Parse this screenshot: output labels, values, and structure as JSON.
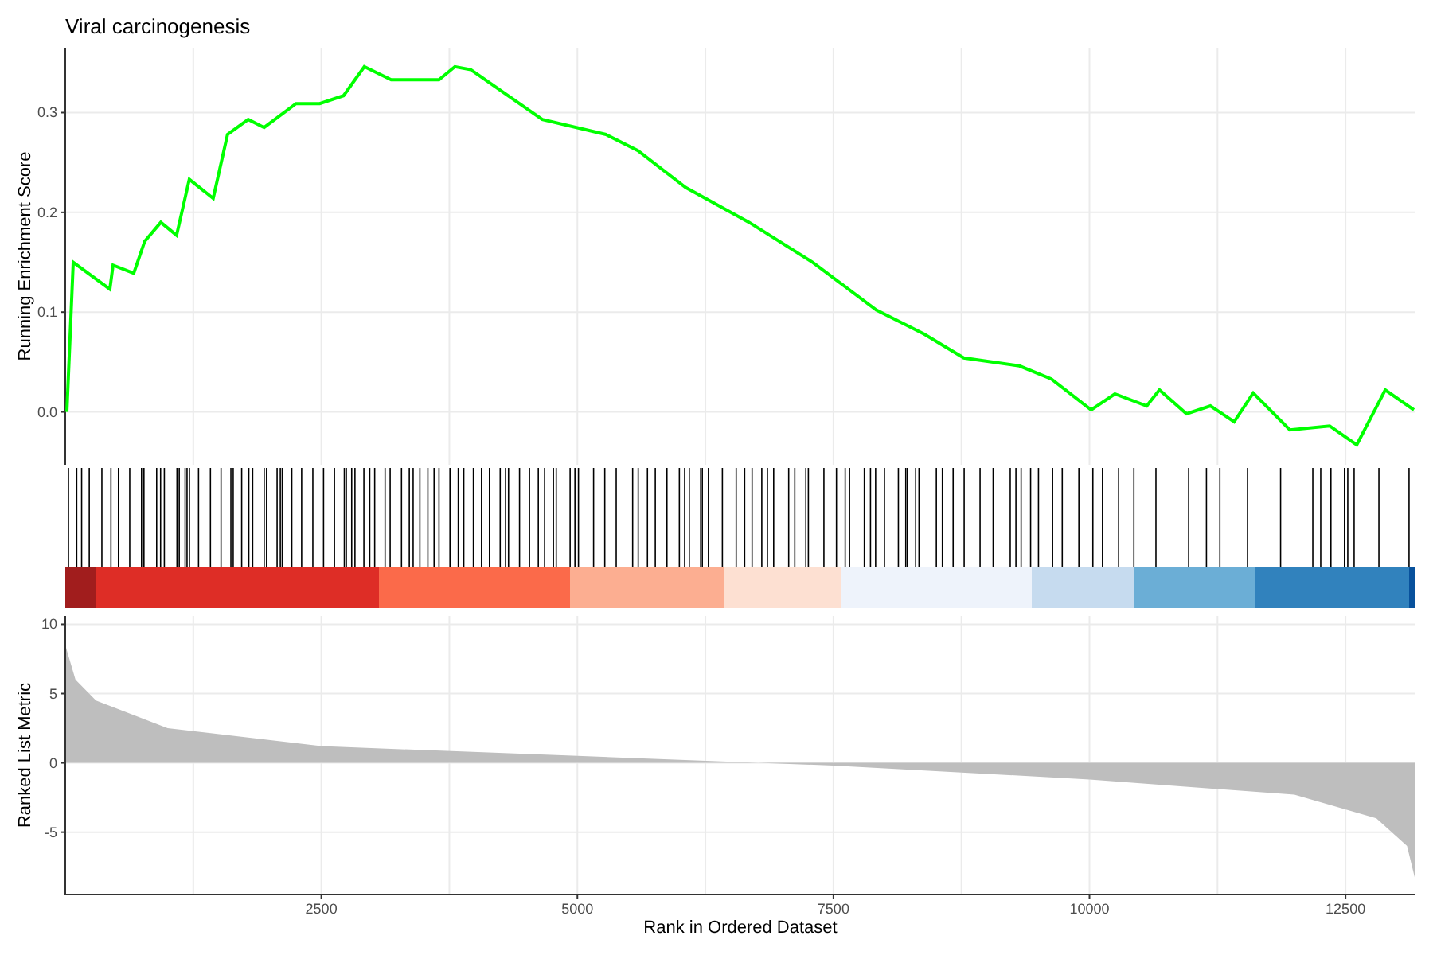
{
  "title": "Viral carcinogenesis",
  "enrichment_panel": {
    "chart_data": {
      "type": "line",
      "ylabel": "Running Enrichment Score",
      "xlim": [
        0,
        13183
      ],
      "ylim": [
        -0.053,
        0.365
      ],
      "grid": true,
      "yticks": [
        {
          "value": 0,
          "label": "0.0"
        },
        {
          "value": 0.1,
          "label": "0.1"
        },
        {
          "value": 0.2,
          "label": "0.2"
        },
        {
          "value": 0.3,
          "label": "0.3"
        }
      ],
      "x": [
        15,
        78,
        435,
        466,
        668,
        776,
        932,
        1087,
        1211,
        1444,
        1584,
        1786,
        1941,
        2252,
        2484,
        2717,
        2919,
        3183,
        3649,
        3804,
        3960,
        4658,
        5280,
        5590,
        6056,
        6677,
        7298,
        7919,
        8385,
        8773,
        9317,
        9627,
        10016,
        10248,
        10559,
        10683,
        10947,
        11180,
        11413,
        11599,
        11956,
        12345,
        12609,
        12888,
        13168
      ],
      "series": [
        {
          "color": "#00ff00",
          "values": [
            0,
            0.15,
            0.123,
            0.147,
            0.139,
            0.171,
            0.19,
            0.177,
            0.233,
            0.214,
            0.278,
            0.293,
            0.285,
            0.309,
            0.309,
            0.317,
            0.346,
            0.333,
            0.333,
            0.346,
            0.343,
            0.293,
            0.278,
            0.262,
            0.225,
            0.19,
            0.15,
            0.102,
            0.078,
            0.054,
            0.046,
            0.033,
            0.002,
            0.018,
            0.006,
            0.022,
            -0.002,
            0.006,
            -0.01,
            0.019,
            -0.018,
            -0.014,
            -0.033,
            0.022,
            0.002
          ]
        }
      ]
    }
  },
  "metric_panel": {
    "chart_data": {
      "type": "area",
      "xlabel": "Rank in Ordered Dataset",
      "ylabel": "Ranked List Metric",
      "xlim": [
        0,
        13183
      ],
      "ylim": [
        -9.5,
        10.6
      ],
      "grid": true,
      "xticks": [
        2500,
        5000,
        7500,
        10000,
        12500
      ],
      "yticks": [
        -5,
        0,
        5,
        10
      ],
      "x": [
        0,
        100,
        300,
        1000,
        2500,
        5000,
        7500,
        10000,
        12000,
        12800,
        13100,
        13183
      ],
      "series": [
        {
          "color": "#bebebe",
          "values": [
            8.5,
            6,
            4.5,
            2.5,
            1.2,
            0.5,
            -0.2,
            -1.2,
            -2.3,
            -4,
            -6,
            -8.5
          ]
        }
      ]
    }
  }
}
